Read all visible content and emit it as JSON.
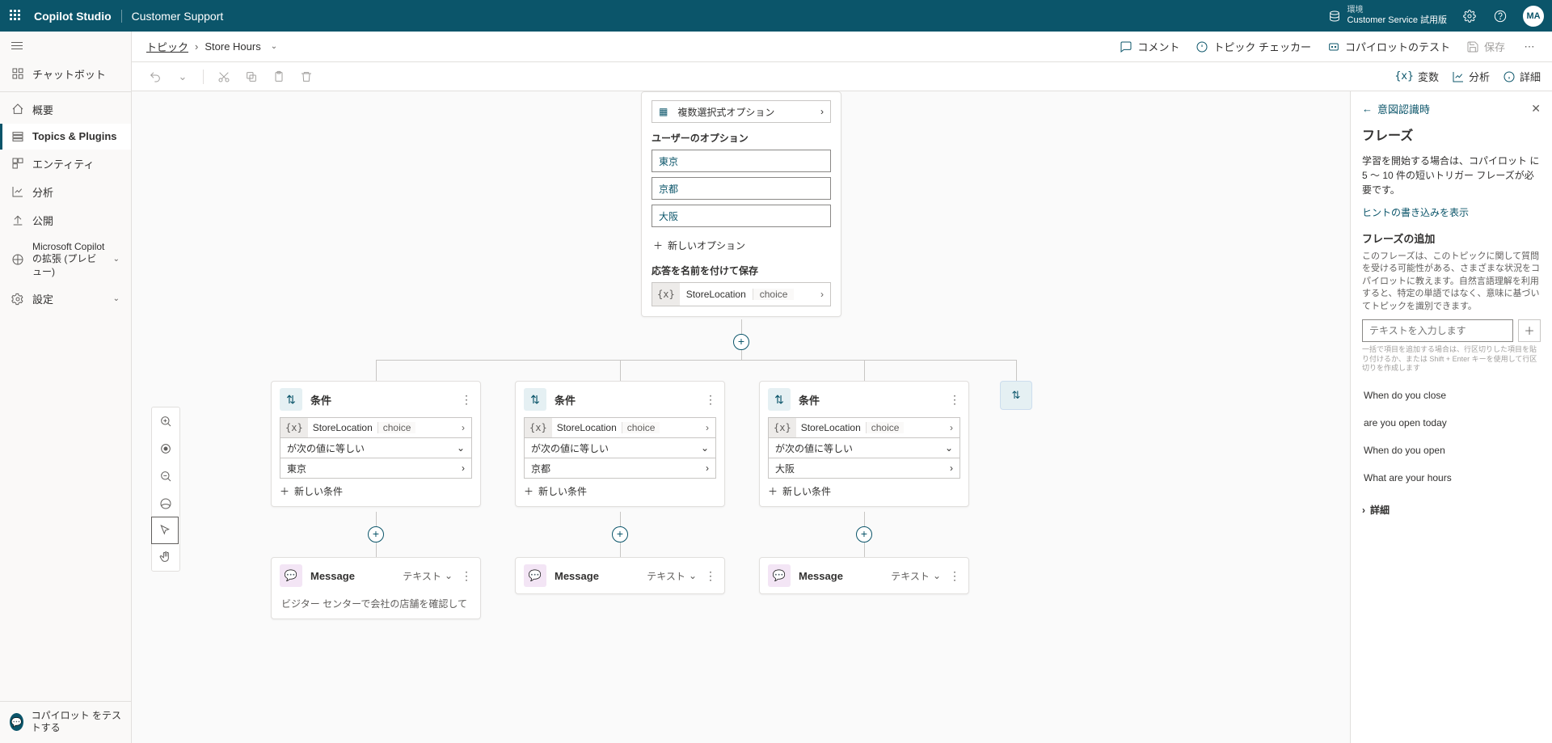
{
  "topbar": {
    "product": "Copilot Studio",
    "app": "Customer Support",
    "env_label": "環境",
    "env_value": "Customer Service 試用版",
    "avatar": "MA"
  },
  "sidebar": {
    "items": [
      {
        "label": "チャットボット"
      },
      {
        "label": "概要"
      },
      {
        "label": "Topics & Plugins"
      },
      {
        "label": "エンティティ"
      },
      {
        "label": "分析"
      },
      {
        "label": "公開"
      },
      {
        "label": "Microsoft Copilot の拡張 (プレビュー)"
      },
      {
        "label": "設定"
      }
    ],
    "test_label": "コパイロット をテストする"
  },
  "crumb": {
    "root": "トピック",
    "current": "Store Hours"
  },
  "crumb_actions": {
    "comment": "コメント",
    "checker": "トピック チェッカー",
    "test": "コパイロットのテスト",
    "save": "保存"
  },
  "toolright": {
    "vars": "変数",
    "analytics": "分析",
    "details": "詳細"
  },
  "question": {
    "identify": "複数選択式オプション",
    "opts_label": "ユーザーのオプション",
    "opts": [
      "東京",
      "京都",
      "大阪"
    ],
    "add_opt": "新しいオプション",
    "save_label": "応答を名前を付けて保存",
    "var_name": "StoreLocation",
    "var_type": "choice"
  },
  "cond": {
    "title": "条件",
    "var_name": "StoreLocation",
    "var_type": "choice",
    "op": "が次の値に等しい",
    "vals": [
      "東京",
      "京都",
      "大阪"
    ],
    "add": "新しい条件"
  },
  "msg": {
    "title": "Message",
    "type": "テキスト",
    "body": "ビジター センターで会社の店舗を確認して"
  },
  "rpanel": {
    "back": "意図認識時",
    "title": "フレーズ",
    "p1": "学習を開始する場合は、コパイロット に 5 〜 10 件の短いトリガー フレーズが必要です。",
    "link": "ヒントの書き込みを表示",
    "sub": "フレーズの追加",
    "desc": "このフレーズは、このトピックに関して質問を受ける可能性がある、さまざまな状況をコパイロットに教えます。自然言語理解を利用すると、特定の単語ではなく、意味に基づいてトピックを識別できます。",
    "placeholder": "テキストを入力します",
    "hint": "一括で項目を追加する場合は、行区切りした項目を貼り付けるか、または Shift + Enter キーを使用して行区切りを作成します",
    "phrases": [
      "When do you close",
      "are you open today",
      "When do you open",
      "What are your hours"
    ],
    "detail": "詳細"
  }
}
